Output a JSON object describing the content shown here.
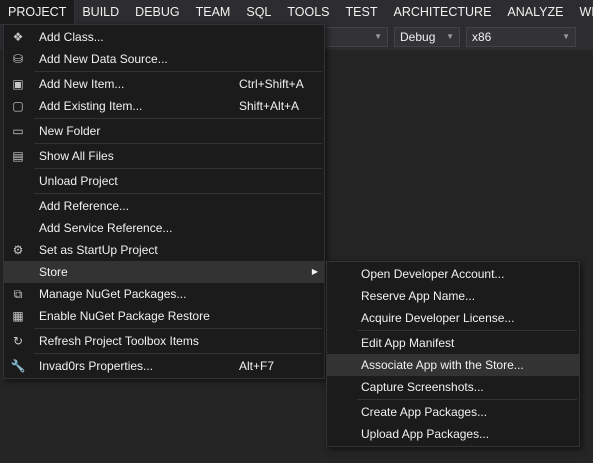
{
  "menubar": {
    "items": [
      "PROJECT",
      "BUILD",
      "DEBUG",
      "TEAM",
      "SQL",
      "TOOLS",
      "TEST",
      "ARCHITECTURE",
      "ANALYZE",
      "WIND"
    ]
  },
  "toolbar": {
    "config_value": "Debug",
    "platform_value": "x86"
  },
  "project_menu": {
    "add_class": "Add Class...",
    "add_data_source": "Add New Data Source...",
    "add_new_item": "Add New Item...",
    "add_new_item_shortcut": "Ctrl+Shift+A",
    "add_existing_item": "Add Existing Item...",
    "add_existing_item_shortcut": "Shift+Alt+A",
    "new_folder": "New Folder",
    "show_all_files": "Show All Files",
    "unload_project": "Unload Project",
    "add_reference": "Add Reference...",
    "add_service_reference": "Add Service Reference...",
    "set_startup": "Set as StartUp Project",
    "store": "Store",
    "manage_nuget": "Manage NuGet Packages...",
    "enable_nuget_restore": "Enable NuGet Package Restore",
    "refresh_toolbox": "Refresh Project Toolbox Items",
    "properties": "Invad0rs Properties...",
    "properties_shortcut": "Alt+F7"
  },
  "store_menu": {
    "open_dev_account": "Open Developer Account...",
    "reserve_app_name": "Reserve App Name...",
    "acquire_license": "Acquire Developer License...",
    "edit_manifest": "Edit App Manifest",
    "associate_app": "Associate App with the Store...",
    "capture_screenshots": "Capture Screenshots...",
    "create_packages": "Create App Packages...",
    "upload_packages": "Upload App Packages..."
  }
}
